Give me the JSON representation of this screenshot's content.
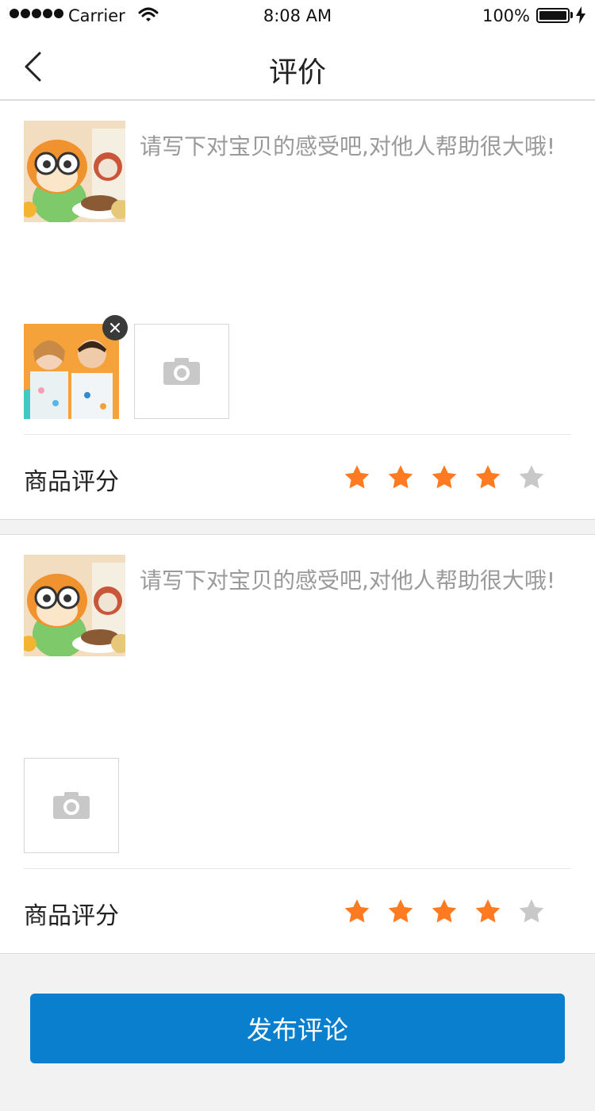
{
  "status_bar": {
    "carrier": "Carrier",
    "time": "8:08 AM",
    "battery": "100%"
  },
  "nav": {
    "title": "评价",
    "back_icon": "chevron-left-icon"
  },
  "reviews": [
    {
      "placeholder": "请写下对宝贝的感受吧,对他人帮助很大哦!",
      "rating_label": "商品评分",
      "rating": 4,
      "max_rating": 5,
      "photos_attached": 1
    },
    {
      "placeholder": "请写下对宝贝的感受吧,对他人帮助很大哦!",
      "rating_label": "商品评分",
      "rating": 4,
      "max_rating": 5,
      "photos_attached": 0
    }
  ],
  "submit_label": "发布评论",
  "colors": {
    "star_active": "#ff7a21",
    "star_inactive": "#c8c8c8",
    "button": "#0a7fce",
    "background": "#f2f2f2"
  }
}
